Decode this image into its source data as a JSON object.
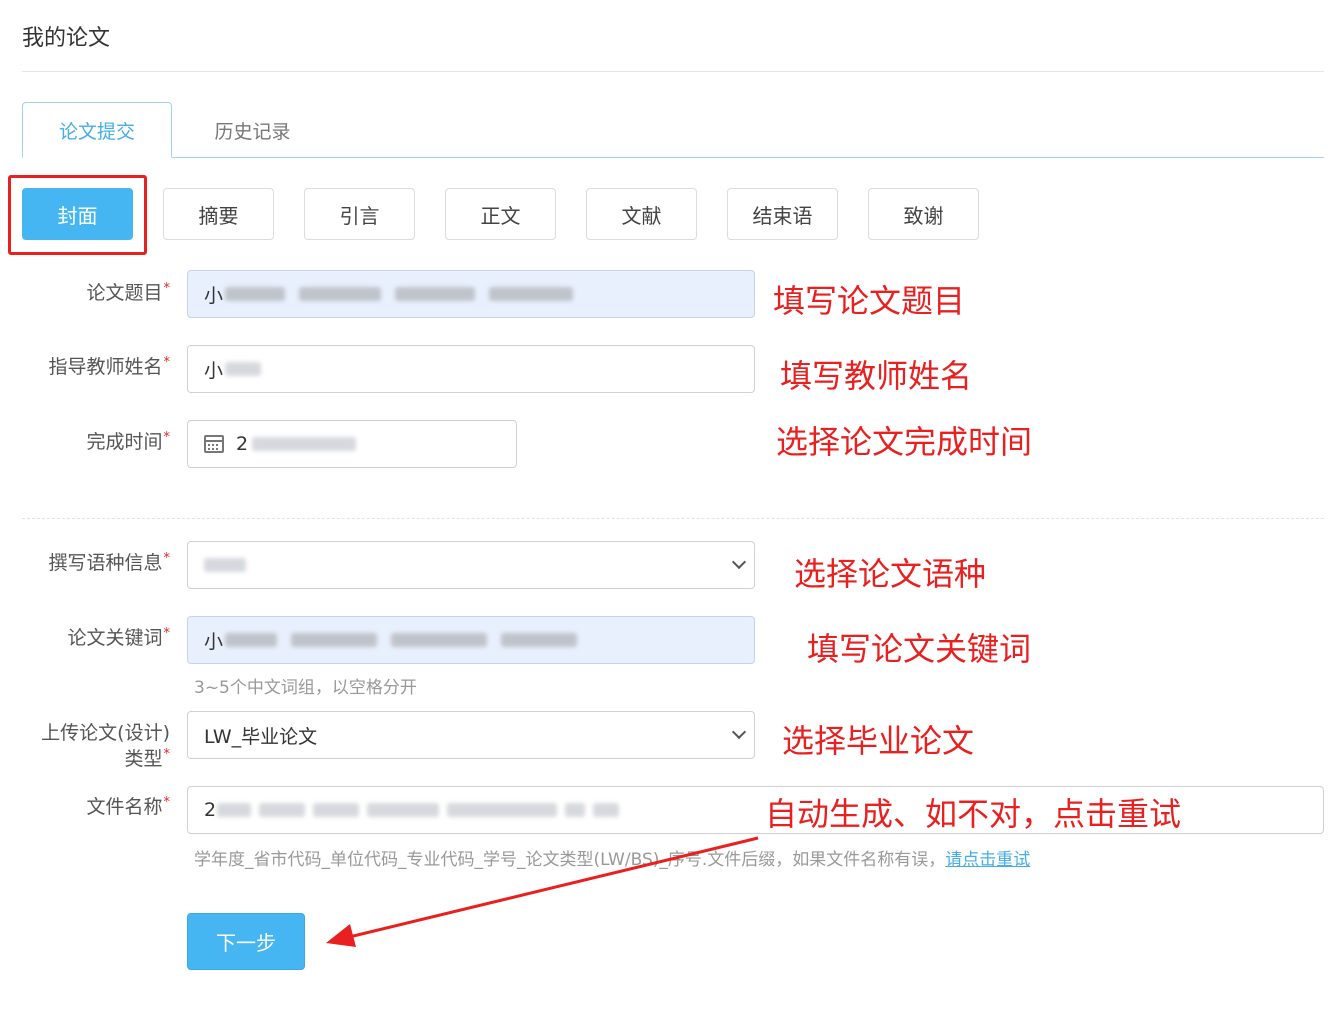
{
  "page": {
    "title": "我的论文"
  },
  "tabs": [
    {
      "label": "论文提交",
      "active": true
    },
    {
      "label": "历史记录",
      "active": false
    }
  ],
  "section_buttons": [
    "封面",
    "摘要",
    "引言",
    "正文",
    "文献",
    "结束语",
    "致谢"
  ],
  "active_section": "封面",
  "form": {
    "title": {
      "label": "论文题目",
      "required": "*",
      "visible_prefix": "小"
    },
    "advisor": {
      "label": "指导教师姓名",
      "required": "*",
      "visible_prefix": "小"
    },
    "completion_time": {
      "label": "完成时间",
      "required": "*",
      "visible_prefix": "2"
    },
    "language": {
      "label": "撰写语种信息",
      "required": "*"
    },
    "keywords": {
      "label": "论文关键词",
      "required": "*",
      "visible_prefix": "小",
      "hint": "3~5个中文词组，以空格分开"
    },
    "upload_type": {
      "label_line1": "上传论文(设计)",
      "label_line2": "类型",
      "required": "*",
      "value": "LW_毕业论文"
    },
    "file_name": {
      "label": "文件名称",
      "required": "*",
      "visible_prefix": "2",
      "hint": "学年度_省市代码_单位代码_专业代码_学号_论文类型(LW/BS)_序号.文件后缀，如果文件名称有误，",
      "retry_link": "请点击重试"
    }
  },
  "annotations": {
    "title": "填写论文题目",
    "advisor": "填写教师姓名",
    "time": "选择论文完成时间",
    "language": "选择论文语种",
    "keywords": "填写论文关键词",
    "type": "选择毕业论文",
    "filename": "自动生成、如不对，点击重试"
  },
  "next_button": "下一步",
  "colors": {
    "accent": "#45b6f2",
    "annotation_red": "#e82020",
    "filled_input_bg": "#e8f0fd"
  }
}
